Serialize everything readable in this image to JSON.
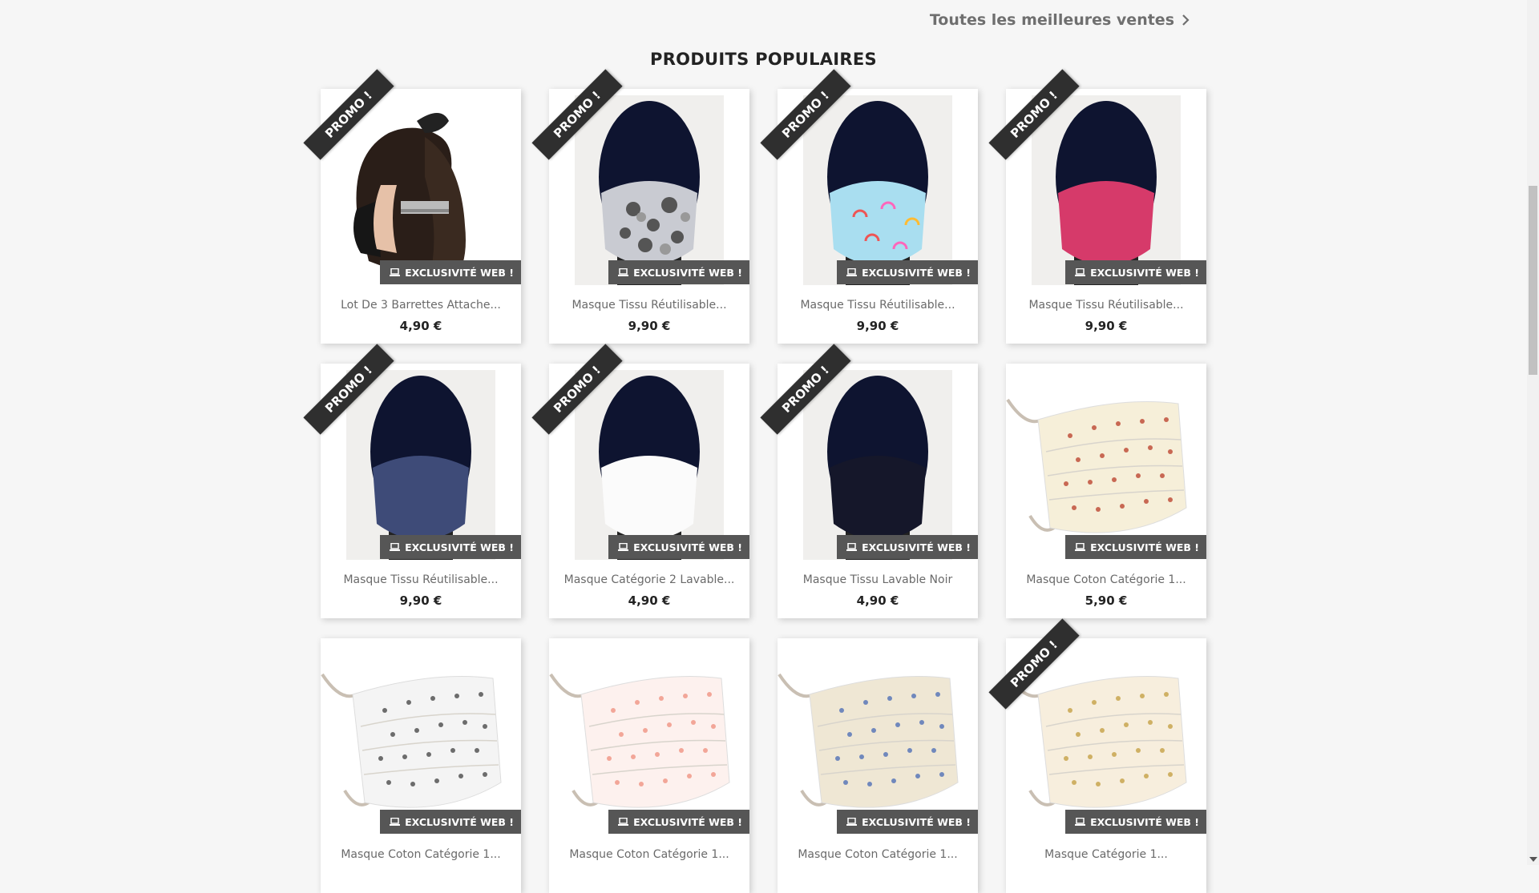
{
  "header": {
    "all_bestsellers_label": "Toutes les meilleures ventes"
  },
  "section": {
    "title": "PRODUITS POPULAIRES"
  },
  "badges": {
    "promo": "PROMO !",
    "exclusive": "EXCLUSIVITÉ WEB !"
  },
  "products": [
    {
      "name": "Lot De 3 Barrettes Attache...",
      "price": "4,90 €",
      "promo": true,
      "image": "ponytail-woman-black-mask"
    },
    {
      "name": "Masque Tissu Réutilisable...",
      "price": "9,90 €",
      "promo": true,
      "image": "grey-camouflage-mask"
    },
    {
      "name": "Masque Tissu Réutilisable...",
      "price": "9,90 €",
      "promo": true,
      "image": "blue-rainbow-print-mask"
    },
    {
      "name": "Masque Tissu Réutilisable...",
      "price": "9,90 €",
      "promo": true,
      "image": "pink-mask"
    },
    {
      "name": "Masque Tissu Réutilisable...",
      "price": "9,90 €",
      "promo": true,
      "image": "navy-mask"
    },
    {
      "name": "Masque Catégorie 2 Lavable...",
      "price": "4,90 €",
      "promo": true,
      "image": "white-mask"
    },
    {
      "name": "Masque Tissu Lavable Noir",
      "price": "4,90 €",
      "promo": true,
      "image": "black-mask"
    },
    {
      "name": "Masque Coton Catégorie 1...",
      "price": "5,90 €",
      "promo": false,
      "image": "floral-pleated-mask"
    },
    {
      "name": "Masque Coton Catégorie 1...",
      "price": "",
      "promo": false,
      "image": "speckled-pleated-mask"
    },
    {
      "name": "Masque Coton Catégorie 1...",
      "price": "",
      "promo": false,
      "image": "pink-dot-pleated-mask"
    },
    {
      "name": "Masque Coton Catégorie 1...",
      "price": "",
      "promo": false,
      "image": "blue-paisley-pleated-mask"
    },
    {
      "name": "Masque Catégorie 1...",
      "price": "",
      "promo": true,
      "image": "cream-circle-pleated-mask"
    }
  ],
  "colors": {
    "background": "#f6f6f6",
    "promo_badge": "#2f2f2f",
    "exclusive_badge": "#565656",
    "price": "#232323"
  }
}
